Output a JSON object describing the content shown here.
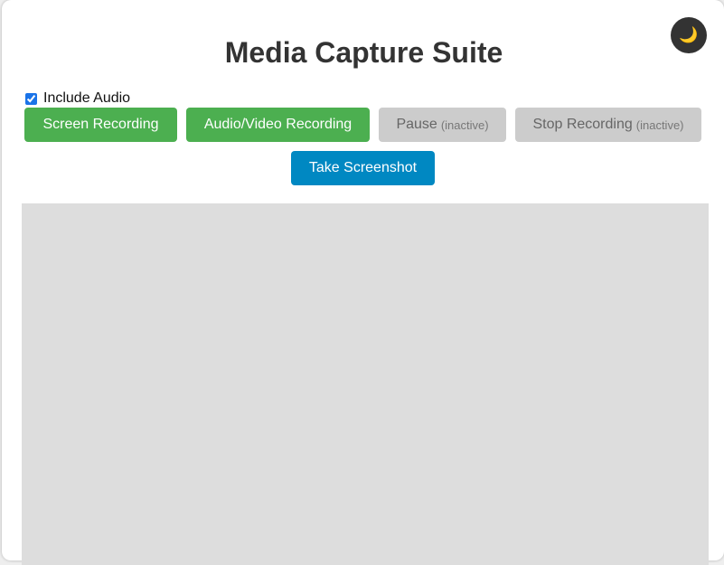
{
  "page": {
    "title": "Media Capture Suite",
    "theme_icon": "🌙"
  },
  "options": {
    "include_audio_label": "Include Audio",
    "include_audio_checked": true
  },
  "buttons": {
    "screen_recording": "Screen Recording",
    "av_recording": "Audio/Video Recording",
    "pause": "Pause",
    "pause_state": "(inactive)",
    "stop": "Stop Recording",
    "stop_state": "(inactive)",
    "screenshot": "Take Screenshot"
  },
  "colors": {
    "green": "#4caf50",
    "disabled": "#cccccc",
    "blue": "#0088c2",
    "preview": "#dddddd"
  }
}
